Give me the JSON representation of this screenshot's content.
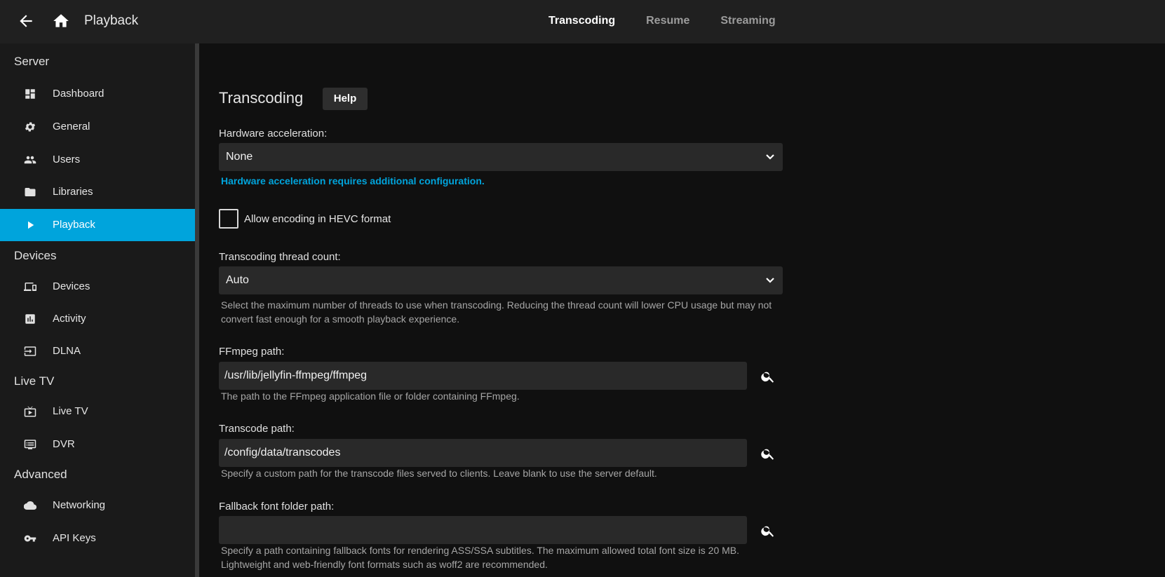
{
  "header": {
    "title": "Playback",
    "tabs": [
      {
        "label": "Transcoding",
        "active": true
      },
      {
        "label": "Resume",
        "active": false
      },
      {
        "label": "Streaming",
        "active": false
      }
    ]
  },
  "sidebar": {
    "sections": [
      {
        "title": "Server",
        "items": [
          "Dashboard",
          "General",
          "Users",
          "Libraries",
          "Playback"
        ]
      },
      {
        "title": "Devices",
        "items": [
          "Devices",
          "Activity",
          "DLNA"
        ]
      },
      {
        "title": "Live TV",
        "items": [
          "Live TV",
          "DVR"
        ]
      },
      {
        "title": "Advanced",
        "items": [
          "Networking",
          "API Keys"
        ]
      }
    ],
    "active_item": "Playback",
    "accent_color": "#00a4dc"
  },
  "main": {
    "title": "Transcoding",
    "help_label": "Help",
    "hw_accel": {
      "label": "Hardware acceleration:",
      "value": "None",
      "note": "Hardware acceleration requires additional configuration."
    },
    "hevc": {
      "label": "Allow encoding in HEVC format",
      "checked": false
    },
    "threads": {
      "label": "Transcoding thread count:",
      "value": "Auto",
      "description": "Select the maximum number of threads to use when transcoding. Reducing the thread count will lower CPU usage but may not convert fast enough for a smooth playback experience."
    },
    "ffmpeg": {
      "label": "FFmpeg path:",
      "value": "/usr/lib/jellyfin-ffmpeg/ffmpeg",
      "description": "The path to the FFmpeg application file or folder containing FFmpeg."
    },
    "transcode": {
      "label": "Transcode path:",
      "value": "/config/data/transcodes",
      "description": "Specify a custom path for the transcode files served to clients. Leave blank to use the server default."
    },
    "fallback_font": {
      "label": "Fallback font folder path:",
      "value": "",
      "description": "Specify a path containing fallback fonts for rendering ASS/SSA subtitles. The maximum allowed total font size is 20 MB. Lightweight and web-friendly font formats such as woff2 are recommended."
    }
  }
}
